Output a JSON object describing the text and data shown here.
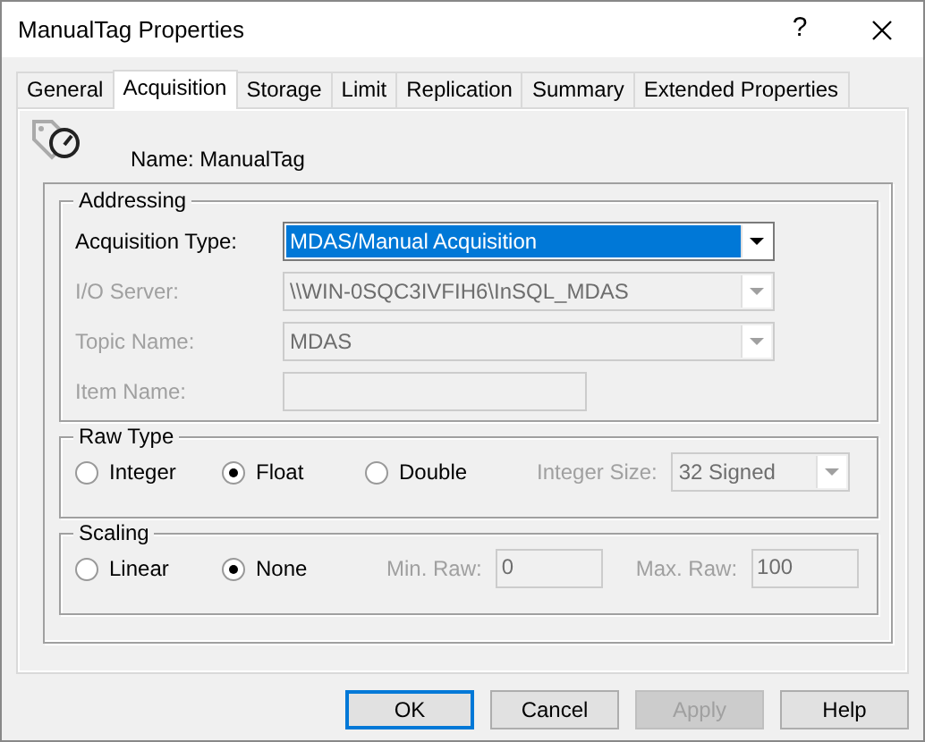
{
  "window": {
    "title": "ManualTag Properties",
    "help": "?"
  },
  "tabs": [
    {
      "label": "General",
      "selected": false
    },
    {
      "label": "Acquisition",
      "selected": true
    },
    {
      "label": "Storage",
      "selected": false
    },
    {
      "label": "Limit",
      "selected": false
    },
    {
      "label": "Replication",
      "selected": false
    },
    {
      "label": "Summary",
      "selected": false
    },
    {
      "label": "Extended Properties",
      "selected": false
    }
  ],
  "tag_name": "Name: ManualTag",
  "addressing": {
    "title": "Addressing",
    "fields": [
      {
        "label": "Acquisition Type:",
        "kind": "combo",
        "value": "MDAS/Manual Acquisition",
        "disabled": false,
        "focused": true
      },
      {
        "label": "I/O Server:",
        "kind": "combo",
        "value": "\\\\WIN-0SQC3IVFIH6\\InSQL_MDAS",
        "disabled": true,
        "focused": false
      },
      {
        "label": "Topic Name:",
        "kind": "combo",
        "value": "MDAS",
        "disabled": true,
        "focused": false
      },
      {
        "label": "Item Name:",
        "kind": "text",
        "disabled": true
      }
    ]
  },
  "raw_type": {
    "title": "Raw Type",
    "options": [
      {
        "label": "Integer",
        "selected": false
      },
      {
        "label": "Float",
        "selected": true
      },
      {
        "label": "Double",
        "selected": false
      }
    ],
    "integer_size": {
      "label": "Integer Size:",
      "value": "32 Signed",
      "disabled": true
    }
  },
  "scaling": {
    "title": "Scaling",
    "options": [
      {
        "label": "Linear",
        "selected": false
      },
      {
        "label": "None",
        "selected": true
      }
    ],
    "min_raw": {
      "label": "Min. Raw:",
      "value": "0",
      "disabled": true
    },
    "max_raw": {
      "label": "Max. Raw:",
      "value": "100",
      "disabled": true
    }
  },
  "buttons": [
    {
      "label": "OK",
      "default": true,
      "disabled": false
    },
    {
      "label": "Cancel",
      "default": false,
      "disabled": false
    },
    {
      "label": "Apply",
      "default": false,
      "disabled": true
    },
    {
      "label": "Help",
      "default": false,
      "disabled": false
    }
  ]
}
